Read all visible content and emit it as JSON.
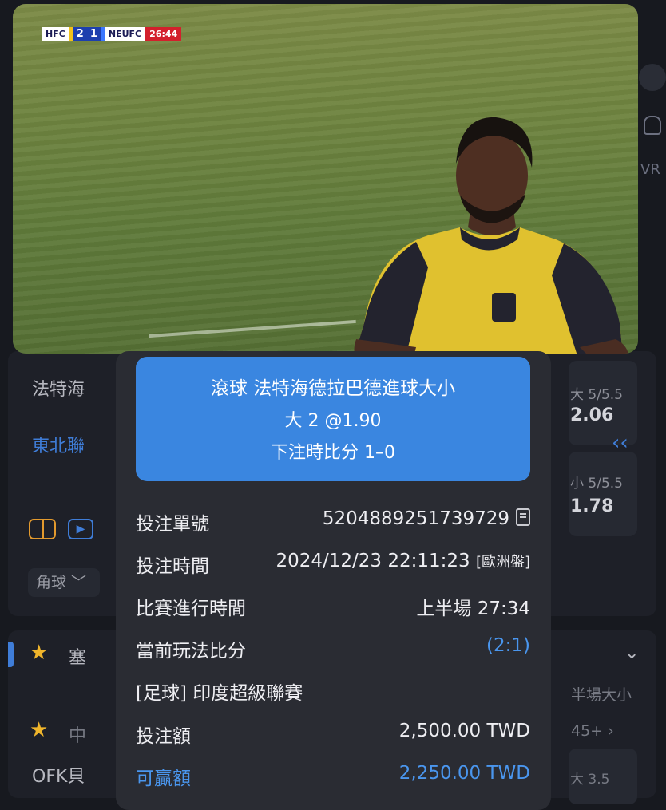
{
  "video": {
    "scorebug": {
      "home": "HFC",
      "home_score": "2",
      "away_score": "1",
      "away": "NEUFC",
      "clock": "26:44"
    },
    "side_text": "VR"
  },
  "background": {
    "team1": "法特海",
    "team2": "東北聯",
    "odds1_label": "大 5/5.5",
    "odds1_value": "2.06",
    "odds2_label": "小 5/5.5",
    "odds2_value": "1.78",
    "corner_chip": "角球 ﹀",
    "section_title": "塞",
    "row_title": "中",
    "row_right": "半場大小",
    "row_count": "45+ ›",
    "team3": "OFK貝",
    "odds3_label": "大 3.5"
  },
  "slip": {
    "header": {
      "line1": "滾球   法特海德拉巴德進球大小",
      "line2": "大 2 @1.90",
      "line3": "下注時比分 1–0"
    },
    "rows": {
      "bet_id_label": "投注單號",
      "bet_id_value": "5204889251739729",
      "bet_time_label": "投注時間",
      "bet_time_value": "2024/12/23 22:11:23",
      "bet_time_suffix": "[歐洲盤]",
      "match_time_label": "比賽進行時間",
      "match_time_value": "上半場 27:34",
      "current_score_label": "當前玩法比分",
      "current_score_value": "(2:1)",
      "league": "[足球] 印度超級聯賽",
      "stake_label": "投注額",
      "stake_value": "2,500.00 TWD",
      "win_label": "可贏額",
      "win_value": "2,250.00 TWD"
    }
  }
}
